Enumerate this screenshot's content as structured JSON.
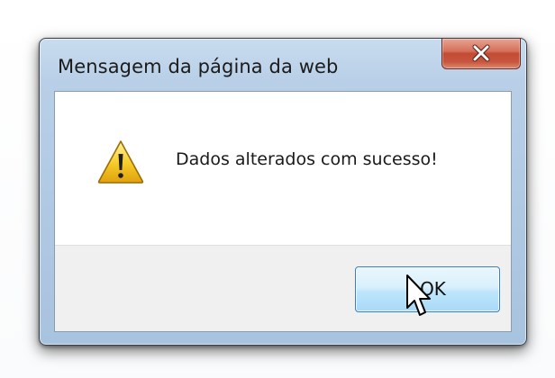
{
  "dialog": {
    "title": "Mensagem da página da web",
    "message": "Dados alterados com sucesso!",
    "ok_label": "OK",
    "close_glyph": "X",
    "icon": "warning-icon"
  },
  "colors": {
    "title_bar": "#b8cfe7",
    "close_button": "#c24a34",
    "ok_button": "#bee6fd",
    "warning_fill": "#f3c21b"
  }
}
